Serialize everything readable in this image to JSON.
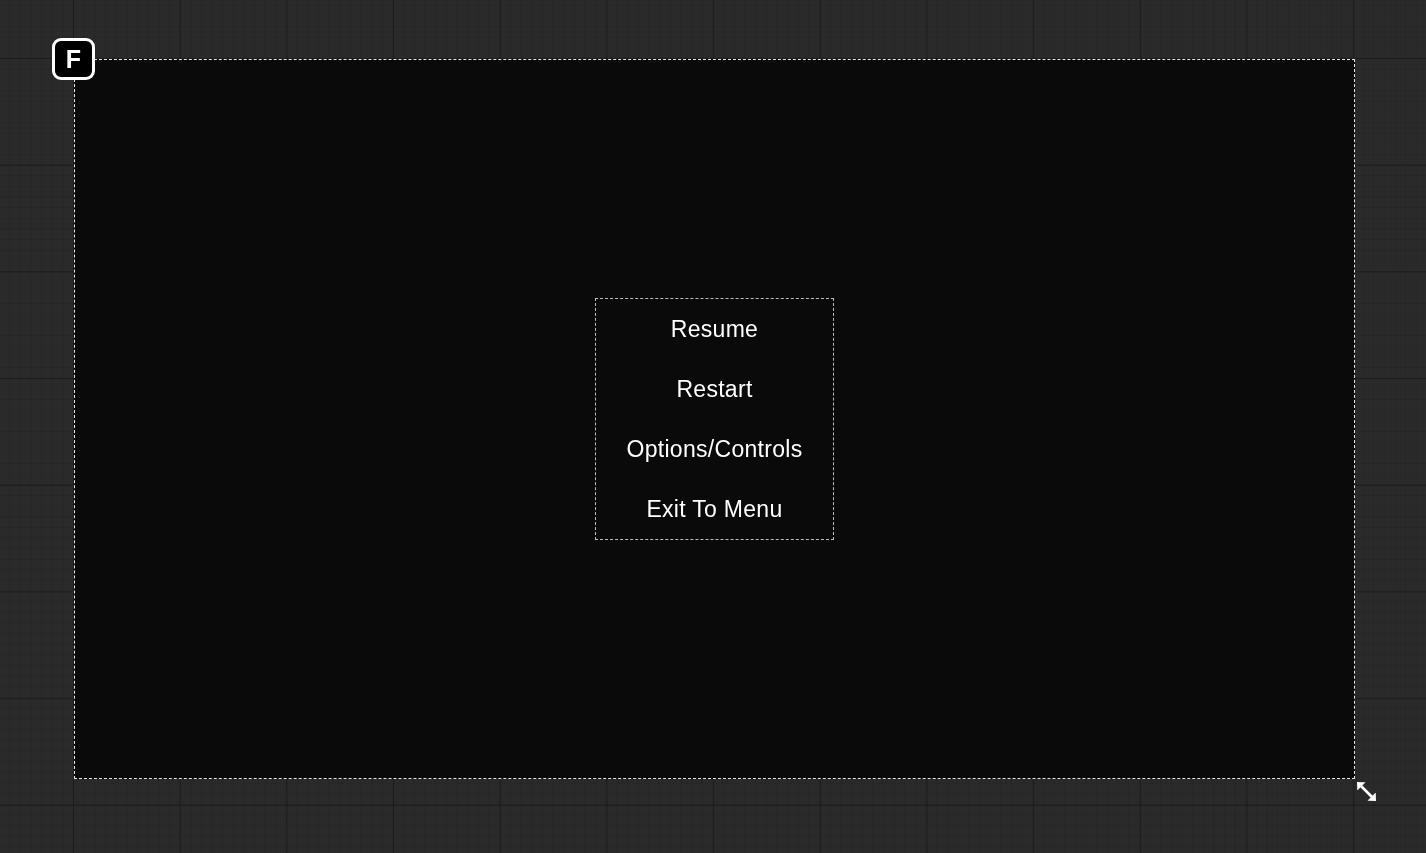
{
  "canvas": {
    "logo_badge": {
      "label": "F"
    },
    "pause_menu": {
      "items": [
        {
          "label": "Resume"
        },
        {
          "label": "Restart"
        },
        {
          "label": "Options/Controls"
        },
        {
          "label": "Exit To Menu"
        }
      ]
    }
  }
}
